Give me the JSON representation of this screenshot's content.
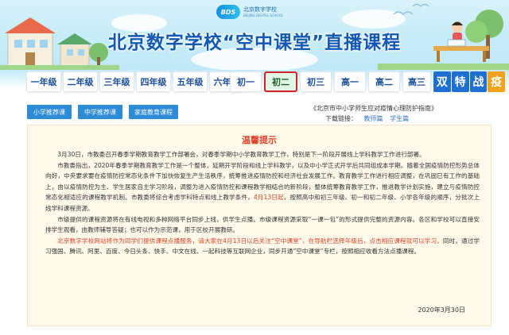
{
  "banner": {
    "logo_mark": "BDS",
    "logo_cn": "北京数字学校",
    "logo_en": "BEIJING DIGITAL SCHOOL",
    "title": "北京数字学校“空中课堂”直播课程"
  },
  "grades": [
    {
      "label": "一年级",
      "active": false
    },
    {
      "label": "二年级",
      "active": false
    },
    {
      "label": "三年级",
      "active": false
    },
    {
      "label": "四年级",
      "active": false
    },
    {
      "label": "五年级",
      "active": false
    },
    {
      "label": "六年级",
      "active": false
    },
    {
      "label": "初一",
      "active": false
    },
    {
      "label": "初二",
      "active": true
    },
    {
      "label": "初三",
      "active": false
    },
    {
      "label": "高一",
      "active": false
    },
    {
      "label": "高二",
      "active": false
    },
    {
      "label": "高三",
      "active": false
    }
  ],
  "shuangte": [
    "双",
    "特",
    "战",
    "疫"
  ],
  "shuangte_colors": [
    "#1f6fd1",
    "#1f6fd1",
    "#1f6fd1",
    "#f2a21d"
  ],
  "tabs": [
    "小学推荐课",
    "中学推荐课",
    "家庭教育课程"
  ],
  "guide": {
    "title": "《北京市中小学师生应对疫情心理防护指南》",
    "download_label": "下载链接：",
    "links": [
      "教师篇",
      "学生篇"
    ]
  },
  "notice": {
    "title": "温馨提示",
    "p1": "3月30日，市教委召开春季学期教育教学工作部署会，对春季学期中小学教育教学工作，特别是下一阶段开展线上学科教学工作进行部署。",
    "p2": "市教委指出，2020年春季学期教育教学工作是一个整体，延期开学阶段和线上学科教学，以及中小学正式开学后共同组成本学期。随着全国疫情防控形势总体向好，中央要求要在疫情防控常态化条件下加快恢复生产生活秩序，统筹推进疫情防控和经济社会发展工作。教育教学工作进行相应调整，在巩固已有工作的基础上，由以疫情防控为主、学生居家自主学习阶段，调整为进入疫情防控和课程教学相结合的新阶段，整体统筹教育教学工作，推进教学计划实施，建立与疫情防控常态化相适应的课程教学机制。市教委将综合考虑学科特点和线上教学条件，",
    "p2_highlight": "4月13日起",
    "p2_tail": "，按照高中和初三年级、初一和初二年级、小学各年级的顺序，分批次上线学科课程资源。",
    "p3": "市级提供的课程资源将在有线电视和多种网络平台同步上线，供学生点播。市级课程资源采取“一课一包”的形式提供完整的资源内容。各区和学校可以直接安排学生观看，由教师辅导答疑；也可以作为示范课，用于区校开展教研。",
    "p4_red": "北京数字学校网站将作为同学们提供课程点播服务，请大家在4月13日以后关注“空中课堂”，在导航栏选择年级后，点击相应课程就可以学习。",
    "p4": "同时，通过学习强国、腾讯、阿里、百度、今日头条、快手、中文在线、一起科技等互联网企业，同步开通“空中课堂”专栏，按照相应收看方法点播课程。",
    "date": "2020年3月30日"
  }
}
